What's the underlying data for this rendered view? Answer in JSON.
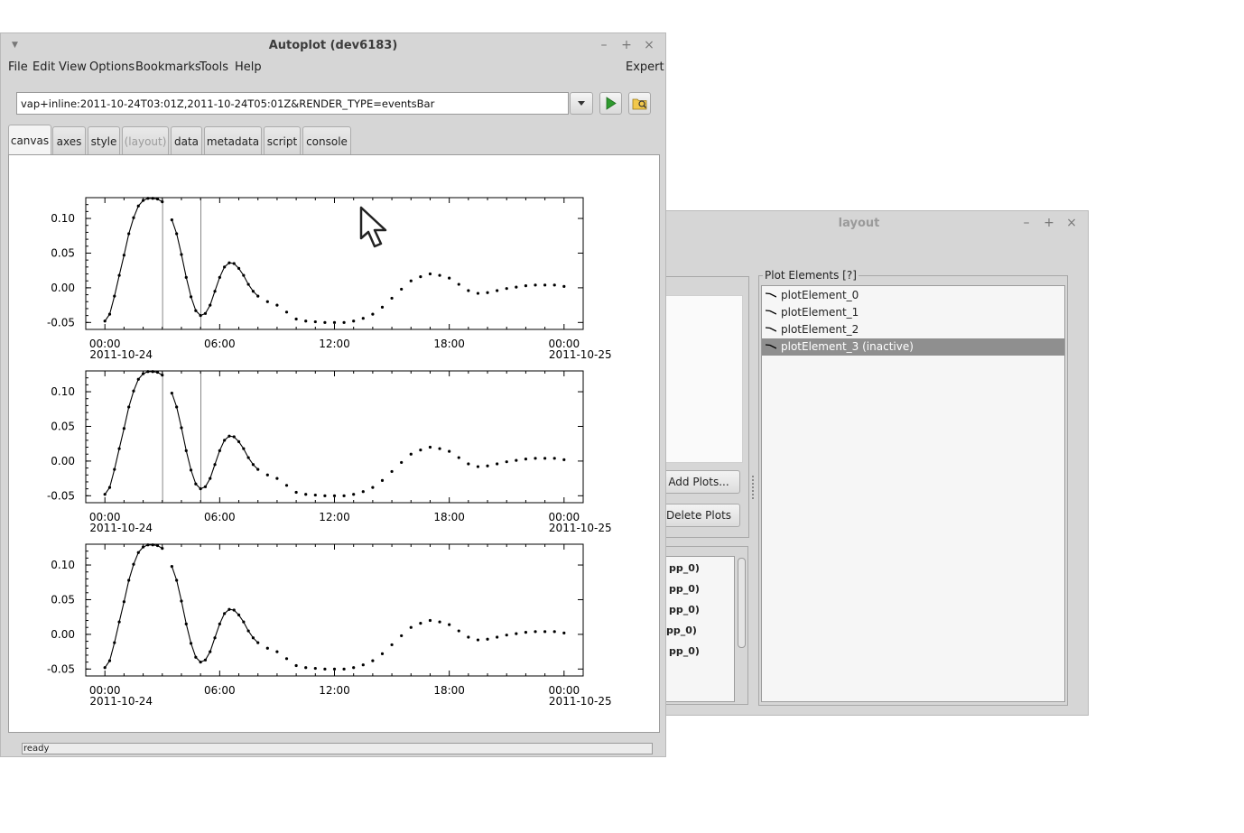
{
  "main_window": {
    "title": "Autoplot (dev6183)",
    "menu": [
      "File",
      "Edit",
      "View",
      "Options",
      "Bookmarks",
      "Tools",
      "Help"
    ],
    "expert_label": "Expert",
    "url_value": "vap+inline:2011-10-24T03:01Z,2011-10-24T05:01Z&RENDER_TYPE=eventsBar",
    "tabs": [
      "canvas",
      "axes",
      "style",
      "(layout)",
      "data",
      "metadata",
      "script",
      "console"
    ],
    "active_tab": "canvas",
    "status": "ready",
    "window_controls": [
      "–",
      "+",
      "×"
    ]
  },
  "layout_window": {
    "title": "layout",
    "window_controls": [
      "–",
      "+",
      "×"
    ],
    "plot_elements_label": "Plot Elements [?]",
    "plot_elements": [
      "plotElement_0",
      "plotElement_1",
      "plotElement_2",
      "plotElement_3 (inactive)"
    ],
    "selected_plot_element": "plotElement_3 (inactive)",
    "add_plots_label": "Add Plots...",
    "delete_plots_label": "Delete Plots",
    "bindings_partial": [
      "pp_0)",
      "pp_0)",
      "pp_0)",
      "pp_0)",
      "pp_0)"
    ]
  },
  "chart_data": [
    {
      "type": "line",
      "xlabel": "",
      "ylabel": "",
      "x_ticks": [
        "00:00",
        "06:00",
        "12:00",
        "18:00",
        "00:00"
      ],
      "x_tick_sublabels": [
        "2011-10-24",
        "",
        "",
        "",
        "2011-10-25"
      ],
      "xlim_hours": [
        -1,
        25
      ],
      "y_ticks": [
        "0.10",
        "0.05",
        "0.00",
        "-0.05"
      ],
      "ylim": [
        -0.06,
        0.13
      ],
      "event_bars_hours": [
        3.0167,
        5.0167
      ],
      "series": [
        {
          "x_hours": [
            0.0,
            0.25,
            0.5,
            0.75,
            1.0,
            1.25,
            1.5,
            1.75,
            2.0,
            2.25,
            2.5,
            2.75,
            3.0,
            3.5,
            3.75,
            4.0,
            4.25,
            4.5,
            4.75,
            5.0,
            5.25,
            5.5,
            5.75,
            6.0,
            6.25,
            6.5,
            6.75,
            7.0,
            7.25,
            7.5,
            7.75,
            8.0,
            8.5,
            9.0,
            9.5,
            10.0,
            10.5,
            11.0,
            11.5,
            12.0,
            12.5,
            13.0,
            13.5,
            14.0,
            14.5,
            15.0,
            15.5,
            16.0,
            16.5,
            17.0,
            17.5,
            18.0,
            18.5,
            19.0,
            19.5,
            20.0,
            20.5,
            21.0,
            21.5,
            22.0,
            22.5,
            23.0,
            23.5,
            24.0
          ],
          "values": [
            -0.048,
            -0.038,
            -0.012,
            0.018,
            0.047,
            0.078,
            0.101,
            0.118,
            0.126,
            0.129,
            0.129,
            0.128,
            0.124,
            0.098,
            0.078,
            0.048,
            0.015,
            -0.013,
            -0.033,
            -0.04,
            -0.037,
            -0.025,
            -0.005,
            0.015,
            0.03,
            0.036,
            0.035,
            0.028,
            0.018,
            0.005,
            -0.005,
            -0.012,
            -0.02,
            -0.025,
            -0.035,
            -0.045,
            -0.048,
            -0.049,
            -0.05,
            -0.05,
            -0.05,
            -0.048,
            -0.044,
            -0.038,
            -0.028,
            -0.015,
            -0.002,
            0.01,
            0.016,
            0.02,
            0.018,
            0.014,
            0.005,
            -0.004,
            -0.008,
            -0.007,
            -0.004,
            -0.001,
            0.001,
            0.003,
            0.004,
            0.004,
            0.004,
            0.002
          ]
        }
      ]
    },
    {
      "type": "line",
      "xlabel": "",
      "ylabel": "",
      "x_ticks": [
        "00:00",
        "06:00",
        "12:00",
        "18:00",
        "00:00"
      ],
      "x_tick_sublabels": [
        "2011-10-24",
        "",
        "",
        "",
        "2011-10-25"
      ],
      "xlim_hours": [
        -1,
        25
      ],
      "y_ticks": [
        "0.10",
        "0.05",
        "0.00",
        "-0.05"
      ],
      "ylim": [
        -0.06,
        0.13
      ],
      "event_bars_hours": [
        3.0167,
        5.0167
      ],
      "series": [
        {
          "x_hours": [
            0.0,
            0.25,
            0.5,
            0.75,
            1.0,
            1.25,
            1.5,
            1.75,
            2.0,
            2.25,
            2.5,
            2.75,
            3.0,
            3.5,
            3.75,
            4.0,
            4.25,
            4.5,
            4.75,
            5.0,
            5.25,
            5.5,
            5.75,
            6.0,
            6.25,
            6.5,
            6.75,
            7.0,
            7.25,
            7.5,
            7.75,
            8.0,
            8.5,
            9.0,
            9.5,
            10.0,
            10.5,
            11.0,
            11.5,
            12.0,
            12.5,
            13.0,
            13.5,
            14.0,
            14.5,
            15.0,
            15.5,
            16.0,
            16.5,
            17.0,
            17.5,
            18.0,
            18.5,
            19.0,
            19.5,
            20.0,
            20.5,
            21.0,
            21.5,
            22.0,
            22.5,
            23.0,
            23.5,
            24.0
          ],
          "values": [
            -0.048,
            -0.038,
            -0.012,
            0.018,
            0.047,
            0.078,
            0.101,
            0.118,
            0.126,
            0.129,
            0.129,
            0.128,
            0.124,
            0.098,
            0.078,
            0.048,
            0.015,
            -0.013,
            -0.033,
            -0.04,
            -0.037,
            -0.025,
            -0.005,
            0.015,
            0.03,
            0.036,
            0.035,
            0.028,
            0.018,
            0.005,
            -0.005,
            -0.012,
            -0.02,
            -0.025,
            -0.035,
            -0.045,
            -0.048,
            -0.049,
            -0.05,
            -0.05,
            -0.05,
            -0.048,
            -0.044,
            -0.038,
            -0.028,
            -0.015,
            -0.002,
            0.01,
            0.016,
            0.02,
            0.018,
            0.014,
            0.005,
            -0.004,
            -0.008,
            -0.007,
            -0.004,
            -0.001,
            0.001,
            0.003,
            0.004,
            0.004,
            0.004,
            0.002
          ]
        }
      ]
    },
    {
      "type": "line",
      "xlabel": "",
      "ylabel": "",
      "x_ticks": [
        "00:00",
        "06:00",
        "12:00",
        "18:00",
        "00:00"
      ],
      "x_tick_sublabels": [
        "2011-10-24",
        "",
        "",
        "",
        "2011-10-25"
      ],
      "xlim_hours": [
        -1,
        25
      ],
      "y_ticks": [
        "0.10",
        "0.05",
        "0.00",
        "-0.05"
      ],
      "ylim": [
        -0.06,
        0.13
      ],
      "event_bars_hours": [],
      "series": [
        {
          "x_hours": [
            0.0,
            0.25,
            0.5,
            0.75,
            1.0,
            1.25,
            1.5,
            1.75,
            2.0,
            2.25,
            2.5,
            2.75,
            3.0,
            3.5,
            3.75,
            4.0,
            4.25,
            4.5,
            4.75,
            5.0,
            5.25,
            5.5,
            5.75,
            6.0,
            6.25,
            6.5,
            6.75,
            7.0,
            7.25,
            7.5,
            7.75,
            8.0,
            8.5,
            9.0,
            9.5,
            10.0,
            10.5,
            11.0,
            11.5,
            12.0,
            12.5,
            13.0,
            13.5,
            14.0,
            14.5,
            15.0,
            15.5,
            16.0,
            16.5,
            17.0,
            17.5,
            18.0,
            18.5,
            19.0,
            19.5,
            20.0,
            20.5,
            21.0,
            21.5,
            22.0,
            22.5,
            23.0,
            23.5,
            24.0
          ],
          "values": [
            -0.048,
            -0.038,
            -0.012,
            0.018,
            0.047,
            0.078,
            0.101,
            0.118,
            0.126,
            0.129,
            0.129,
            0.128,
            0.124,
            0.098,
            0.078,
            0.048,
            0.015,
            -0.013,
            -0.033,
            -0.04,
            -0.037,
            -0.025,
            -0.005,
            0.015,
            0.03,
            0.036,
            0.035,
            0.028,
            0.018,
            0.005,
            -0.005,
            -0.012,
            -0.02,
            -0.025,
            -0.035,
            -0.045,
            -0.048,
            -0.049,
            -0.05,
            -0.05,
            -0.05,
            -0.048,
            -0.044,
            -0.038,
            -0.028,
            -0.015,
            -0.002,
            0.01,
            0.016,
            0.02,
            0.018,
            0.014,
            0.005,
            -0.004,
            -0.008,
            -0.007,
            -0.004,
            -0.001,
            0.001,
            0.003,
            0.004,
            0.004,
            0.004,
            0.002
          ]
        }
      ]
    }
  ],
  "colors": {
    "window_bg": "#d6d6d6",
    "selected_row": "#8f8f8f",
    "plot_line": "#000000"
  },
  "icons": [
    "dropdown-arrow-icon",
    "play-icon",
    "folder-icon",
    "mouse-pointer-icon",
    "line-plot-icon"
  ]
}
